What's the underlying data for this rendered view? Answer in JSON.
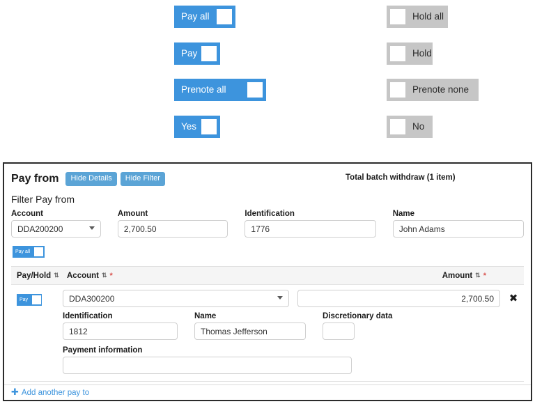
{
  "colors": {
    "accent_blue": "#3d94dd",
    "button_blue": "#5ba4d6",
    "toggle_off_gray": "#c6c6c6",
    "required_red": "#d9534f",
    "panel_border": "#2b2b2b",
    "table_header_bg": "#f5f5f5"
  },
  "toggle_showcase": {
    "on_toggles": [
      {
        "label": "Pay all",
        "state": "on"
      },
      {
        "label": "Pay",
        "state": "on"
      },
      {
        "label": "Prenote all",
        "state": "on"
      },
      {
        "label": "Yes",
        "state": "on"
      }
    ],
    "off_toggles": [
      {
        "label": "Hold all",
        "state": "off"
      },
      {
        "label": "Hold",
        "state": "off"
      },
      {
        "label": "Prenote none",
        "state": "off"
      },
      {
        "label": "No",
        "state": "off"
      }
    ]
  },
  "panel": {
    "title": "Pay from",
    "hide_details_label": "Hide Details",
    "hide_filter_label": "Hide Filter",
    "batch_total": "Total batch withdraw (1 item)",
    "filter_title": "Filter Pay from",
    "filter_fields": {
      "account": {
        "label": "Account",
        "value": "DDA200200",
        "placeholder": "",
        "type": "select"
      },
      "amount": {
        "label": "Amount",
        "value": "2,700.50",
        "placeholder": "",
        "type": "text"
      },
      "identification": {
        "label": "Identification",
        "value": "1776",
        "placeholder": "",
        "type": "text"
      },
      "name": {
        "label": "Name",
        "value": "John Adams",
        "placeholder": "",
        "type": "text"
      }
    },
    "pay_all_toggle": {
      "label": "Pay all",
      "state": "on"
    },
    "table": {
      "headers": {
        "pay_hold": "Pay/Hold",
        "account": "Account",
        "amount": "Amount",
        "sort_icon": "⇅",
        "required_marker": "*"
      },
      "rows": [
        {
          "pay_toggle": {
            "label": "Pay",
            "state": "on"
          },
          "account": "DDA300200",
          "amount": "2,700.50",
          "delete_icon": "✖",
          "details": {
            "identification": {
              "label": "Identification",
              "value": "1812",
              "placeholder": ""
            },
            "name": {
              "label": "Name",
              "value": "Thomas Jefferson",
              "placeholder": ""
            },
            "discretionary_data": {
              "label": "Discretionary data",
              "value": "",
              "placeholder": ""
            },
            "payment_information": {
              "label": "Payment information",
              "value": "",
              "placeholder": ""
            }
          }
        }
      ]
    },
    "footer": {
      "add_label": "Add another pay to",
      "plus_icon": "✚"
    }
  }
}
